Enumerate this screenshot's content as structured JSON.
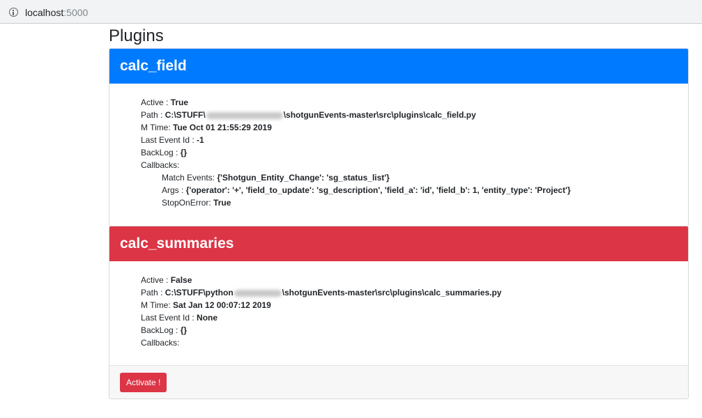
{
  "browser": {
    "url_host": "localhost",
    "url_port": ":5000"
  },
  "page": {
    "title": "Plugins"
  },
  "labels": {
    "active": "Active : ",
    "path": "Path : ",
    "mtime": "M Time: ",
    "last_event_id": "Last Event Id : ",
    "backlog": "BackLog : ",
    "callbacks": "Callbacks:",
    "match_events": "Match Events: ",
    "args": "Args : ",
    "stop_on_error": "StopOnError: "
  },
  "plugins": [
    {
      "name": "calc_field",
      "header_color": "#007bff",
      "active": "True",
      "path_start": "C:\\STUFF\\",
      "path_end": "\\shotgunEvents-master\\src\\plugins\\calc_field.py",
      "mtime": "Tue Oct 01 21:55:29 2019",
      "last_event_id": "-1",
      "backlog": "{}",
      "callback": {
        "match_events": "{'Shotgun_Entity_Change': 'sg_status_list'}",
        "args": "{'operator': '+', 'field_to_update': 'sg_description', 'field_a': 'id', 'field_b': 1, 'entity_type': 'Project'}",
        "stop_on_error": "True"
      }
    },
    {
      "name": "calc_summaries",
      "header_color": "#dc3545",
      "active": "False",
      "path_start": "C:\\STUFF\\python",
      "path_end": "\\shotgunEvents-master\\src\\plugins\\calc_summaries.py",
      "mtime": "Sat Jan 12 00:07:12 2019",
      "last_event_id": "None",
      "backlog": "{}",
      "activate_label": "Activate !"
    }
  ]
}
